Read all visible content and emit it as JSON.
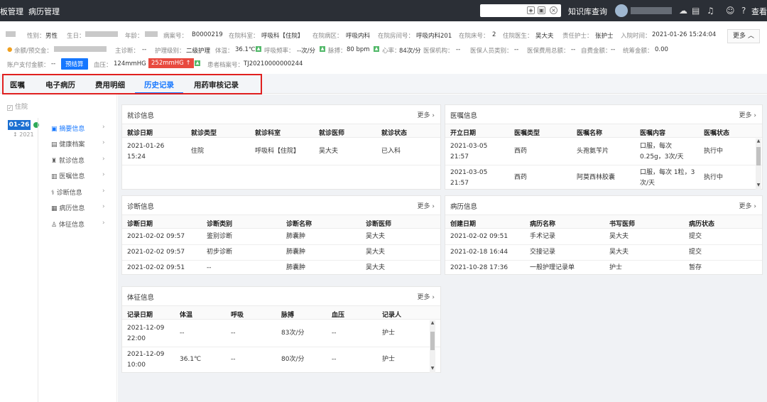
{
  "topnav": {
    "menu_1": "板管理",
    "menu_2": "病历管理",
    "knowledge": "知识库查询",
    "view": "查看"
  },
  "patient": {
    "row1": {
      "gender_label": "性别：",
      "gender": "男性",
      "birth_label": "生日：",
      "age_label": "年龄：",
      "case_no_label": "病案号：",
      "case_no": "B0000219",
      "dept_label": "在院科室：",
      "dept": "呼吸科【住院】",
      "ward_label": "在院病区：",
      "ward": "呼吸内科",
      "room_label": "在院房间号：",
      "room": "呼吸内科201",
      "bed_label": "在院床号：",
      "bed": "2",
      "doctor_label": "住院医生：",
      "doctor": "吴大夫",
      "nurse_label": "责任护士：",
      "nurse": "张护士",
      "admit_label": "入院时间：",
      "admit": "2021-01-26 15:24:04",
      "more": "更多"
    },
    "row2": {
      "balance_label": "余额/预交金：",
      "diag_label": "主诊断：",
      "diag": "--",
      "care_label": "护理级别：",
      "care": "二级护理",
      "temp_label": "体温：",
      "temp": "36.1℃",
      "resp_label": "呼吸频率：",
      "resp": "--次/分",
      "pulse_label": "脉搏：",
      "pulse": "80 bpm",
      "hr_label": "心率：",
      "hr": "84次/分",
      "inst_label": "医保机构：",
      "inst": "--",
      "ins_type_label": "医保人员类别：",
      "ins_type": "--",
      "ins_fee_label": "医保费用总额：",
      "ins_fee": "--",
      "self_label": "自费金额：",
      "self": "--",
      "pool_label": "统筹金额：",
      "pool": "0.00"
    },
    "row3": {
      "acct_label": "账户支付金额：",
      "acct": "--",
      "settle_button": "预结算",
      "bp_label": "血压：",
      "bp_low": "124mmHG -",
      "bp_high": "252mmHG ↑",
      "file_label": "患者档案号：",
      "file": "TJ20210000000244"
    }
  },
  "tabs": [
    "医嘱",
    "电子病历",
    "费用明细",
    "历史记录",
    "用药审核记录"
  ],
  "left": {
    "inhosp": "住院",
    "date": "01-26",
    "year": "2021",
    "nav": [
      "摘要信息",
      "健康档案",
      "就诊信息",
      "医嘱信息",
      "诊断信息",
      "病历信息",
      "体征信息"
    ],
    "nav_icons": [
      "summary-icon",
      "health-record-icon",
      "visit-icon",
      "order-icon",
      "diagnosis-icon",
      "medical-record-icon",
      "vital-sign-icon"
    ]
  },
  "visit": {
    "title": "就诊信息",
    "more": "更多",
    "headers": [
      "就诊日期",
      "就诊类型",
      "就诊科室",
      "就诊医师",
      "就诊状态"
    ],
    "rows": [
      [
        "2021-01-26 15:24",
        "住院",
        "呼吸科【住院】",
        "吴大夫",
        "已入科"
      ]
    ]
  },
  "orders": {
    "title": "医嘱信息",
    "more": "更多",
    "headers": [
      "开立日期",
      "医嘱类型",
      "医嘱名称",
      "医嘱内容",
      "医嘱状态"
    ],
    "rows": [
      [
        "2021-03-05 21:57",
        "西药",
        "头孢氨苄片",
        "口服，每次 0.25g，3次/天",
        "执行中"
      ],
      [
        "2021-03-05 21:57",
        "西药",
        "阿莫西林胶囊",
        "口服，每次 1粒，3次/天",
        "执行中"
      ]
    ]
  },
  "diagnosis": {
    "title": "诊断信息",
    "more": "更多",
    "headers": [
      "诊断日期",
      "诊断类别",
      "诊断名称",
      "诊断医师"
    ],
    "rows": [
      [
        "2021-02-02 09:57",
        "鉴别诊断",
        "肺囊肿",
        "吴大夫"
      ],
      [
        "2021-02-02 09:57",
        "初步诊断",
        "肺囊肿",
        "吴大夫"
      ],
      [
        "2021-02-02 09:51",
        "--",
        "肺囊肿",
        "吴大夫"
      ]
    ]
  },
  "records": {
    "title": "病历信息",
    "more": "更多",
    "headers": [
      "创建日期",
      "病历名称",
      "书写医师",
      "病历状态"
    ],
    "rows": [
      [
        "2021-02-02 09:51",
        "手术记录",
        "吴大夫",
        "提交"
      ],
      [
        "2021-02-18 16:44",
        "交接记录",
        "吴大夫",
        "提交"
      ],
      [
        "2021-10-28 17:36",
        "一般护理记录单",
        "护士",
        "暂存"
      ]
    ]
  },
  "vitals": {
    "title": "体征信息",
    "more": "更多",
    "headers": [
      "记录日期",
      "体温",
      "呼吸",
      "脉搏",
      "血压",
      "记录人"
    ],
    "rows": [
      [
        "2021-12-09 22:00",
        "--",
        "--",
        "83次/分",
        "--",
        "护士"
      ],
      [
        "2021-12-09 10:00",
        "36.1℃",
        "--",
        "80次/分",
        "--",
        "护士"
      ]
    ]
  },
  "colors": {
    "accent": "#1677ff",
    "alert": "#e84a3f",
    "topbar": "#2b2f36",
    "highlight_box": "#e02020"
  }
}
